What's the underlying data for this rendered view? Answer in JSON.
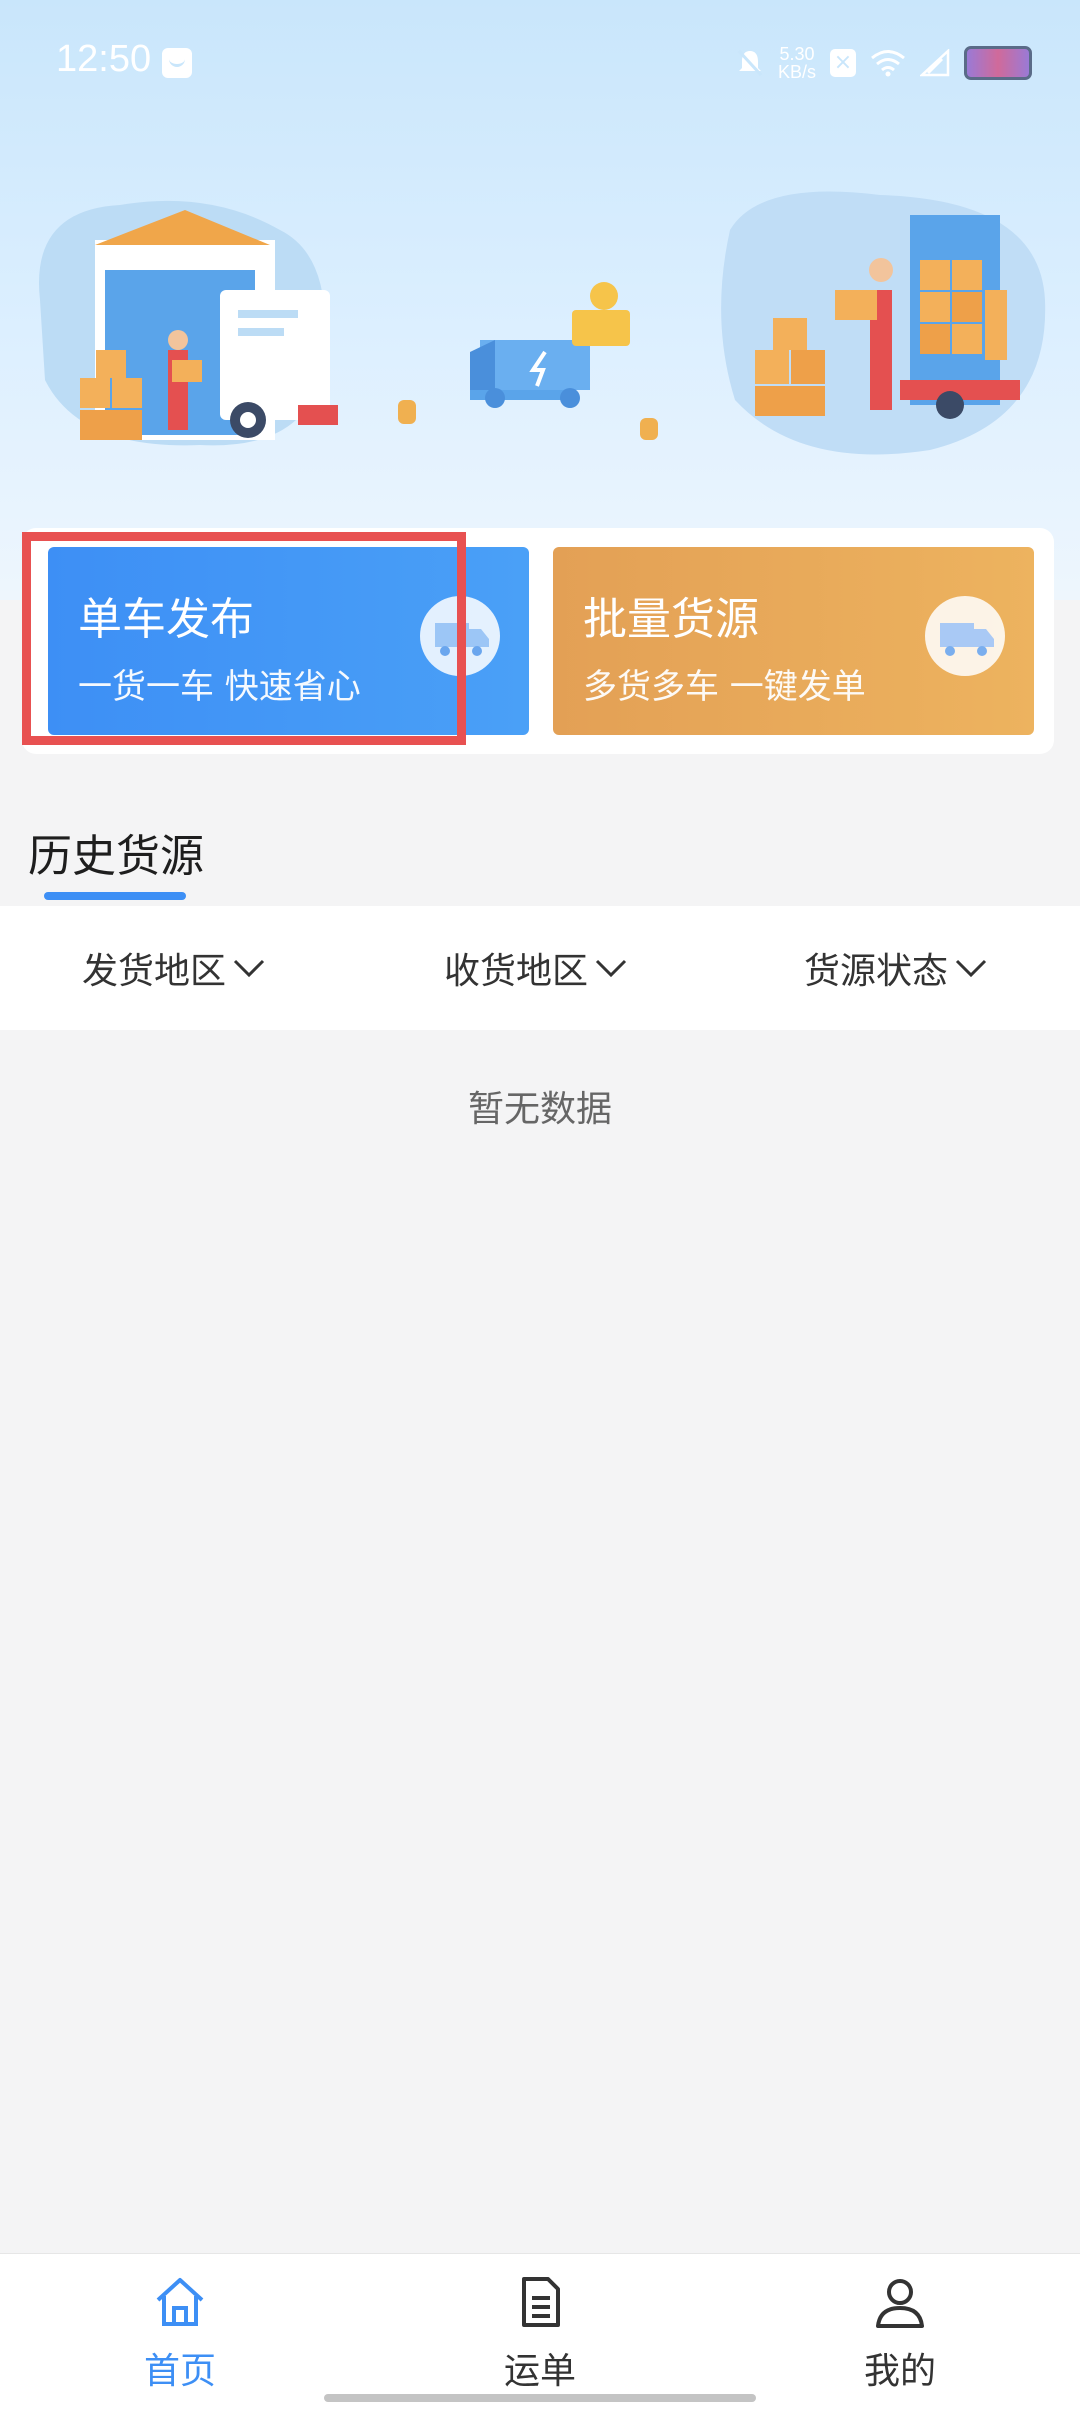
{
  "status_bar": {
    "time": "12:50",
    "net_speed_value": "5.30",
    "net_speed_unit": "KB/s"
  },
  "cards": {
    "single": {
      "title": "单车发布",
      "subtitle": "一货一车 快速省心"
    },
    "batch": {
      "title": "批量货源",
      "subtitle": "多货多车 一键发单"
    }
  },
  "history": {
    "title": "历史货源",
    "filters": [
      {
        "label": "发货地区"
      },
      {
        "label": "收货地区"
      },
      {
        "label": "货源状态"
      }
    ],
    "empty_text": "暂无数据"
  },
  "tabs": [
    {
      "label": "首页",
      "icon": "home-icon",
      "active": true
    },
    {
      "label": "运单",
      "icon": "document-icon",
      "active": false
    },
    {
      "label": "我的",
      "icon": "profile-icon",
      "active": false
    }
  ],
  "colors": {
    "primary": "#3d8ff5",
    "batch": "#e9a85a",
    "highlight": "#e85151"
  }
}
